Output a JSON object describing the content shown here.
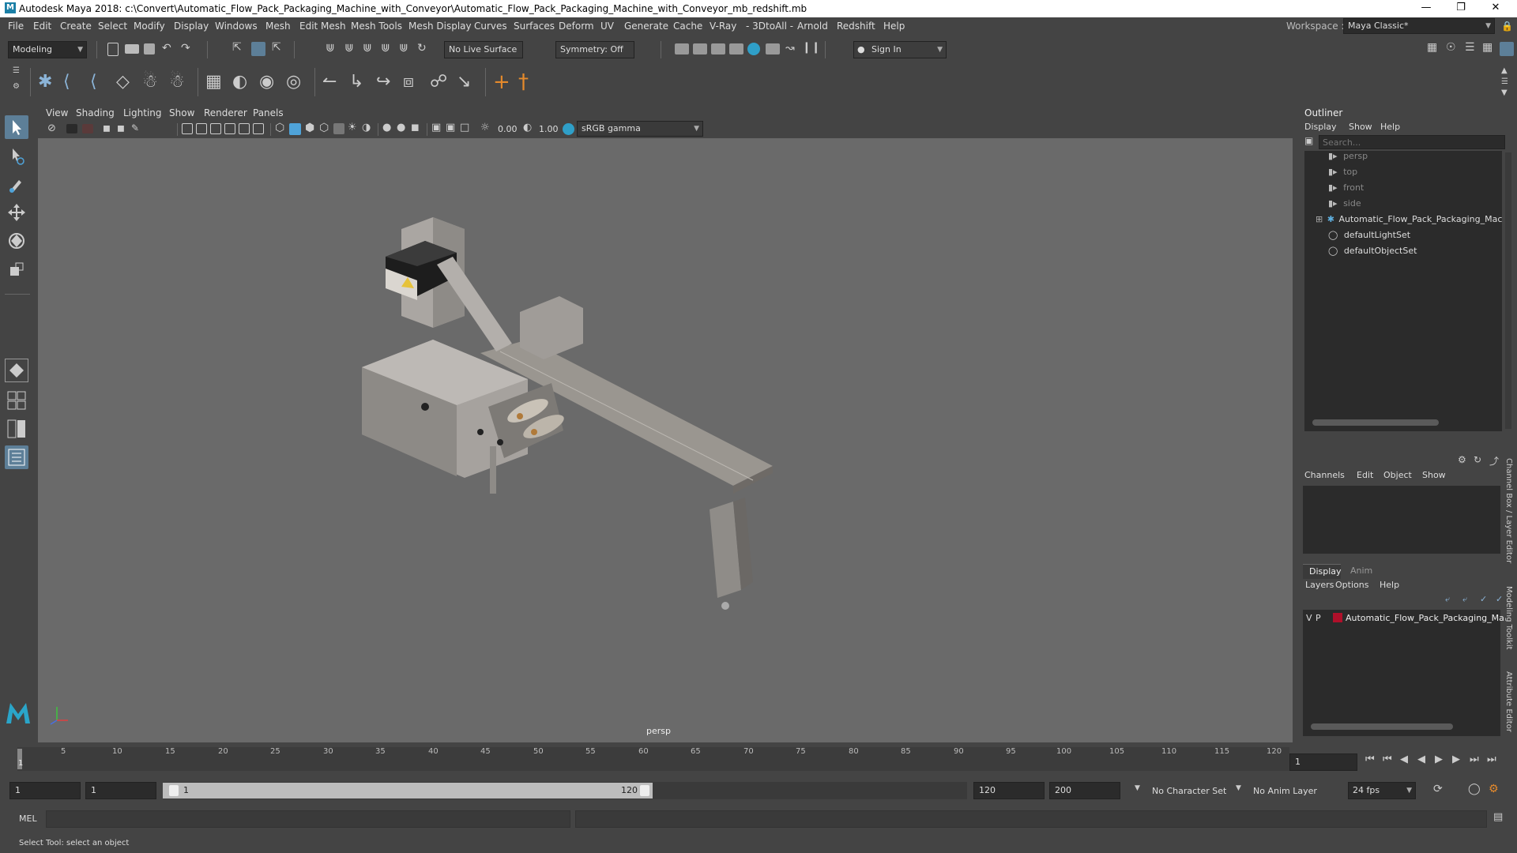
{
  "window": {
    "title": "Autodesk Maya 2018: c:\\Convert\\Automatic_Flow_Pack_Packaging_Machine_with_Conveyor\\Automatic_Flow_Pack_Packaging_Machine_with_Conveyor_mb_redshift.mb",
    "logo": "M"
  },
  "menubar": {
    "items": [
      "File",
      "Edit",
      "Create",
      "Select",
      "Modify",
      "Display",
      "Windows",
      "Mesh",
      "Edit Mesh",
      "Mesh Tools",
      "Mesh Display",
      "Curves",
      "Surfaces",
      "Deform",
      "UV",
      "Generate",
      "Cache",
      "V-Ray",
      "- 3DtoAll -",
      "Arnold",
      "Redshift",
      "Help"
    ],
    "workspace_label": "Workspace :",
    "workspace_value": "Maya Classic*"
  },
  "statusline": {
    "mode": "Modeling",
    "live_surface": "No Live Surface",
    "symmetry": "Symmetry: Off",
    "sign_in": "Sign In"
  },
  "viewport": {
    "menu": [
      "View",
      "Shading",
      "Lighting",
      "Show",
      "Renderer",
      "Panels"
    ],
    "exposure": "0.00",
    "gamma": "1.00",
    "color_space": "sRGB gamma",
    "camera_label": "persp"
  },
  "outliner": {
    "title": "Outliner",
    "menu": [
      "Display",
      "Show",
      "Help"
    ],
    "search_placeholder": "Search...",
    "items": [
      {
        "label": "persp",
        "icon": "camera-icon",
        "dim": true
      },
      {
        "label": "top",
        "icon": "camera-icon",
        "dim": true
      },
      {
        "label": "front",
        "icon": "camera-icon",
        "dim": true
      },
      {
        "label": "side",
        "icon": "camera-icon",
        "dim": true
      },
      {
        "label": "Automatic_Flow_Pack_Packaging_Machi",
        "icon": "group-icon",
        "dim": false
      },
      {
        "label": "defaultLightSet",
        "icon": "set-icon",
        "dim": false
      },
      {
        "label": "defaultObjectSet",
        "icon": "set-icon",
        "dim": false
      }
    ]
  },
  "channelbox": {
    "menu": [
      "Channels",
      "Edit",
      "Object",
      "Show"
    ]
  },
  "layers": {
    "tabs": [
      "Display",
      "Anim"
    ],
    "menu": [
      "Layers",
      "Options",
      "Help"
    ],
    "layer": {
      "v": "V",
      "p": "P",
      "name": "Automatic_Flow_Pack_Packaging_Ma",
      "color": "#b0102a"
    }
  },
  "side_tabs": [
    "Channel Box / Layer Editor",
    "Modeling Toolkit",
    "Attribute Editor"
  ],
  "timeslider": {
    "ticks": [
      "5",
      "10",
      "15",
      "20",
      "25",
      "30",
      "35",
      "40",
      "45",
      "50",
      "55",
      "60",
      "65",
      "70",
      "75",
      "80",
      "85",
      "90",
      "95",
      "100",
      "105",
      "110",
      "115",
      "120"
    ],
    "current_frame_marker": "1",
    "current_frame_field": "1"
  },
  "rangeslider": {
    "start": "1",
    "anim_start": "1",
    "range_start": "1",
    "range_end": "120",
    "end": "120",
    "anim_end": "200",
    "character_set": "No Character Set",
    "anim_layer": "No Anim Layer",
    "fps": "24 fps"
  },
  "cmdline": {
    "label": "MEL"
  },
  "helpline": {
    "text": "Select Tool: select an object"
  }
}
